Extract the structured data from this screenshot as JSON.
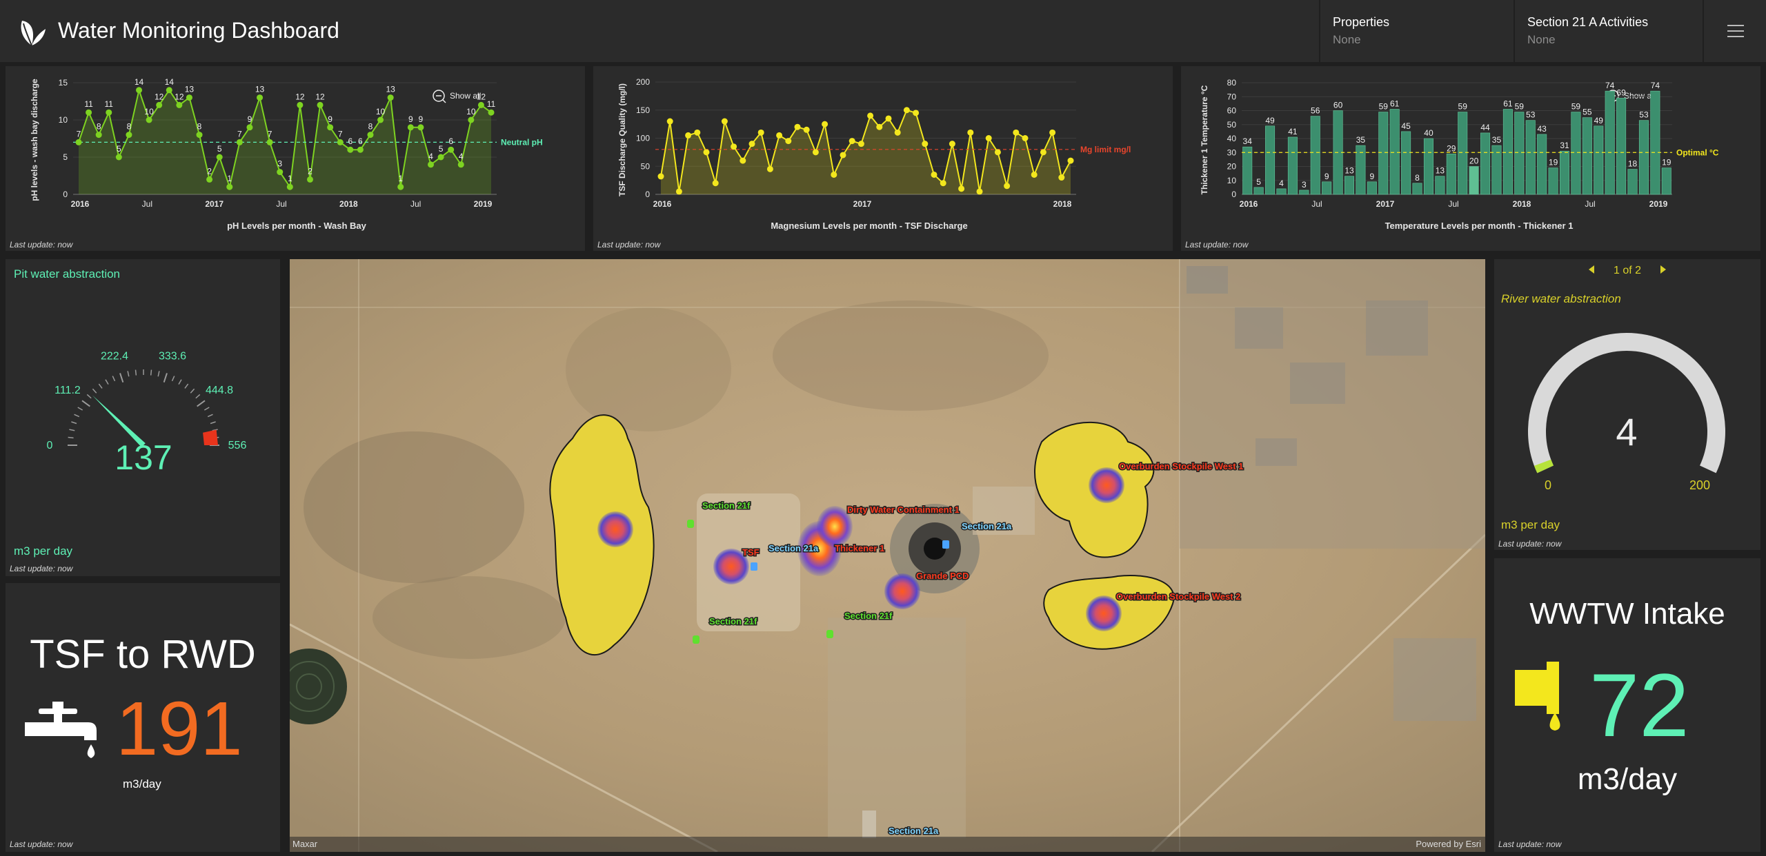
{
  "header": {
    "title": "Water Monitoring Dashboard",
    "selectors": [
      {
        "label": "Properties",
        "value": "None"
      },
      {
        "label": "Section 21 A Activities",
        "value": "None"
      }
    ]
  },
  "last_update": "Last update: now",
  "charts": {
    "ph": {
      "ylabel": "pH levels - wash bay discharge",
      "xlabel": "pH Levels per month - Wash Bay",
      "ref_label": "Neutral pH",
      "show_all": "Show all",
      "ticks_x": [
        "2016",
        "Jul",
        "2017",
        "Jul",
        "2018",
        "Jul",
        "2019"
      ],
      "ticks_y": [
        "0",
        "5",
        "10",
        "15"
      ]
    },
    "mg": {
      "ylabel": "TSF Discharge Quality (mg/l)",
      "xlabel": "Magnesium Levels per month - TSF Discharge",
      "ref_label": "Mg limit mg/l",
      "ticks_x": [
        "2016",
        "2017",
        "2018"
      ],
      "ticks_y": [
        "0",
        "50",
        "100",
        "150",
        "200"
      ]
    },
    "temp": {
      "ylabel": "Thickener 1 Temperature °C",
      "xlabel": "Temperature Levels per month - Thickener 1",
      "ref_label": "Optimal °C",
      "show_all": "Show all",
      "ticks_x": [
        "2016",
        "Jul",
        "2017",
        "Jul",
        "2018",
        "Jul",
        "2019"
      ],
      "ticks_y": [
        "0",
        "10",
        "20",
        "30",
        "40",
        "50",
        "60",
        "70",
        "80"
      ]
    }
  },
  "chart_data": [
    {
      "type": "line",
      "title": "pH Levels per month - Wash Bay",
      "ylabel": "pH levels - wash bay discharge",
      "ylim": [
        0,
        15
      ],
      "reference": {
        "label": "Neutral pH",
        "value": 7
      },
      "values": [
        7,
        11,
        8,
        11,
        5,
        8,
        14,
        10,
        12,
        14,
        12,
        13,
        8,
        2,
        5,
        1,
        7,
        9,
        13,
        7,
        3,
        1,
        12,
        2,
        12,
        9,
        7,
        6,
        6,
        8,
        10,
        13,
        1,
        9,
        9,
        4,
        5,
        6,
        4,
        10,
        12,
        11
      ]
    },
    {
      "type": "line",
      "title": "Magnesium Levels per month - TSF Discharge",
      "ylabel": "TSF Discharge Quality (mg/l)",
      "ylim": [
        0,
        200
      ],
      "reference": {
        "label": "Mg limit mg/l",
        "value": 80
      },
      "values": [
        32,
        130,
        5,
        105,
        110,
        75,
        20,
        130,
        85,
        60,
        90,
        110,
        45,
        105,
        95,
        120,
        115,
        75,
        125,
        35,
        70,
        95,
        90,
        140,
        120,
        135,
        110,
        150,
        145,
        90,
        35,
        20,
        90,
        10,
        110,
        5,
        100,
        75,
        15,
        110,
        100,
        35,
        75,
        110,
        30,
        60
      ]
    },
    {
      "type": "bar",
      "title": "Temperature Levels per month - Thickener 1",
      "ylabel": "Thickener 1 Temperature °C",
      "ylim": [
        0,
        80
      ],
      "reference": {
        "label": "Optimal °C",
        "value": 30
      },
      "values": [
        34,
        5,
        49,
        4,
        41,
        3,
        56,
        9,
        60,
        13,
        35,
        9,
        59,
        61,
        45,
        8,
        40,
        13,
        29,
        59,
        20,
        44,
        35,
        61,
        59,
        53,
        43,
        19,
        31,
        59,
        55,
        49,
        74,
        69,
        18,
        53,
        74,
        19
      ]
    }
  ],
  "pit_gauge": {
    "title": "Pit water abstraction",
    "unit": "m3 per day",
    "value": "137",
    "value_num": 137,
    "max": 556,
    "labels": [
      "0",
      "111.2",
      "222.4",
      "333.6",
      "444.8",
      "556"
    ]
  },
  "tsf": {
    "title": "TSF to RWD",
    "value": "191",
    "unit": "m3/day",
    "icon": "tap-icon"
  },
  "map": {
    "attribution_left": "Maxar",
    "attribution_right": "Powered by Esri",
    "features": [
      {
        "label": "Section 21f",
        "color": "#5fe02f"
      },
      {
        "label": "Section 21f",
        "color": "#5fe02f"
      },
      {
        "label": "Section 21f",
        "color": "#5fe02f"
      },
      {
        "label": "TSF",
        "color": "#ff3b1f"
      },
      {
        "label": "Section 21a",
        "color": "#7fd4ff"
      },
      {
        "label": "Section 21a",
        "color": "#7fd4ff"
      },
      {
        "label": "Section 21a",
        "color": "#7fd4ff"
      },
      {
        "label": "Thickener 1",
        "color": "#ff3b1f"
      },
      {
        "label": "Dirty Water Containment 1",
        "color": "#ff3b1f"
      },
      {
        "label": "Grande PCD",
        "color": "#ff3b1f"
      },
      {
        "label": "Overburden Stockpile West 1",
        "color": "#ff3b1f"
      },
      {
        "label": "Overburden Stockpile West 2",
        "color": "#ff3b1f"
      }
    ]
  },
  "river_gauge": {
    "pager": "1 of 2",
    "title": "River water abstraction",
    "unit": "m3 per day",
    "value": "4",
    "value_num": 4,
    "min_label": "0",
    "max_label": "200",
    "max": 200
  },
  "wwtw": {
    "title": "WWTW Intake",
    "value": "72",
    "unit": "m3/day"
  },
  "colors": {
    "green": "#7ed321",
    "yellow": "#f3e71d",
    "teal": "#3c8f6e",
    "mint": "#5ef0b5",
    "orange": "#f26b21",
    "river_yellow": "#d9d12a"
  }
}
